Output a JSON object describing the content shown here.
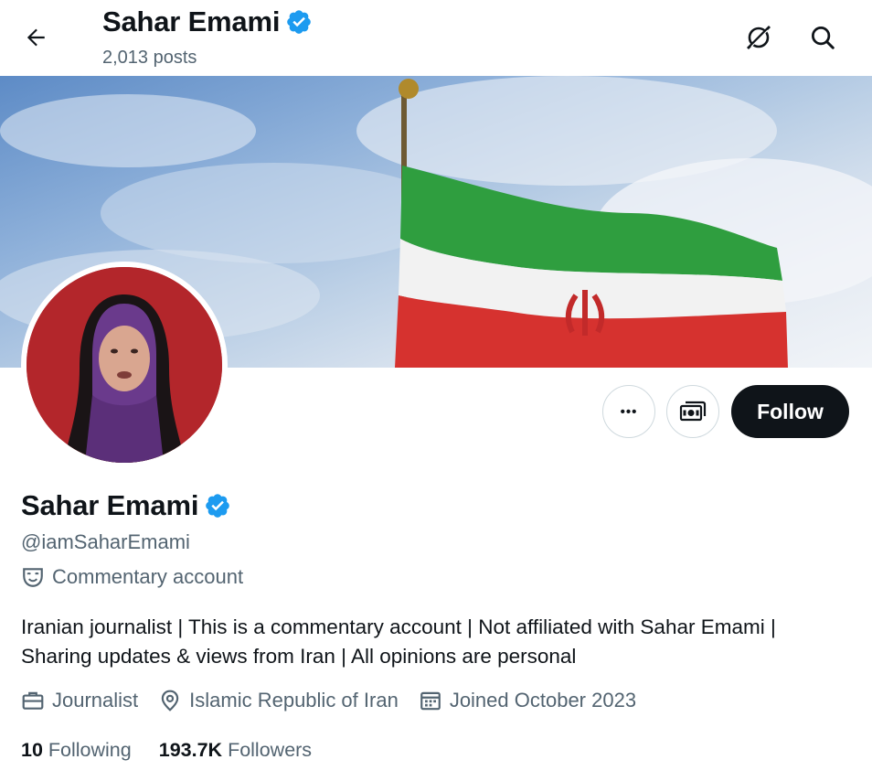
{
  "header": {
    "title": "Sahar Emami",
    "posts_count": "2,013 posts"
  },
  "profile": {
    "name": "Sahar Emami",
    "handle": "@iamSaharEmami",
    "account_label": "Commentary account",
    "bio_line1": "Iranian journalist | This is a commentary account | Not affiliated with Sahar Emami |",
    "bio_line2": "Sharing updates & views from Iran | All opinions are personal",
    "profession": "Journalist",
    "location": "Islamic Republic of Iran",
    "joined": "Joined October 2023",
    "following_count": "10",
    "following_label": "Following",
    "followers_count": "193.7K",
    "followers_label": "Followers"
  },
  "actions": {
    "more_label": "•••",
    "follow_label": "Follow"
  },
  "icons": {
    "back": "arrow-left-icon",
    "grok": "grok-icon",
    "search": "search-icon",
    "verified": "verified-badge-icon",
    "more": "more-icon",
    "subscribe": "subscribe-icon",
    "commentary": "theater-mask-icon",
    "profession": "briefcase-icon",
    "location": "location-pin-icon",
    "joined": "calendar-icon"
  },
  "colors": {
    "verified_blue": "#1d9bf0",
    "text_primary": "#0f1419",
    "text_secondary": "#536471",
    "follow_bg": "#0f1419",
    "border": "#cfd9de"
  }
}
